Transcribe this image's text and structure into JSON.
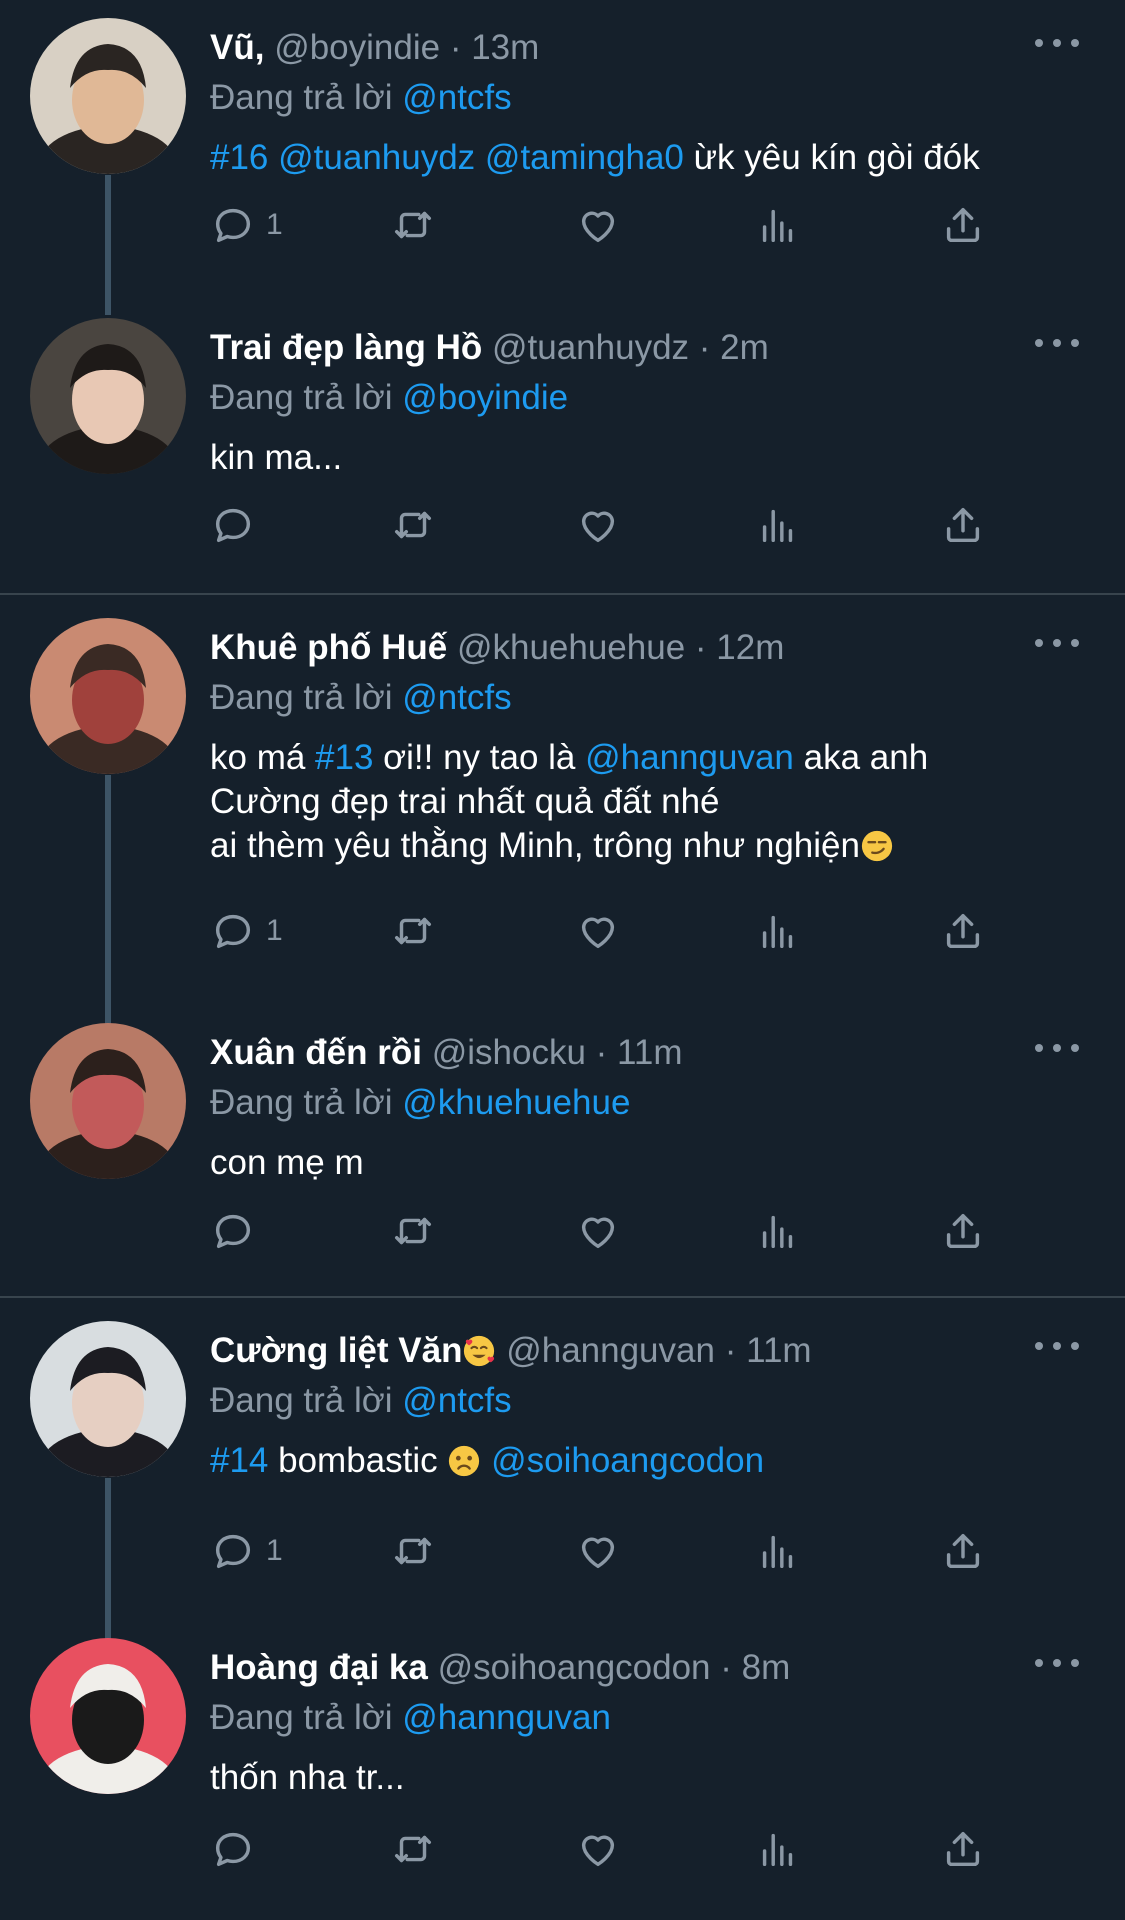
{
  "reply_prefix": "Đang trả lời",
  "tweets": [
    {
      "name": "Vũ,",
      "handle": "@boyindie",
      "time": "13m",
      "reply_to": "@ntcfs",
      "body": [
        [
          {
            "t": "#16",
            "k": "hashtag"
          },
          {
            "t": " ",
            "k": "text"
          },
          {
            "t": "@tuanhuydz",
            "k": "mention"
          },
          {
            "t": " ",
            "k": "text"
          },
          {
            "t": "@tamingha0",
            "k": "mention"
          },
          {
            "t": " ừk yêu kín gòi đók",
            "k": "text"
          }
        ]
      ],
      "reply_count": "1",
      "avatar_colors": [
        "#d8d0c4",
        "#2a2522",
        "#e0b896"
      ]
    },
    {
      "name": "Trai đẹp làng Hồ",
      "handle": "@tuanhuydz",
      "time": "2m",
      "reply_to": "@boyindie",
      "body": [
        [
          {
            "t": "kin ma...",
            "k": "text"
          }
        ]
      ],
      "reply_count": "",
      "avatar_colors": [
        "#4a4540",
        "#1e1a18",
        "#e8c8b4"
      ]
    },
    {
      "name": "Khuê phố Huế",
      "handle": "@khuehuehue",
      "time": "12m",
      "reply_to": "@ntcfs",
      "body": [
        [
          {
            "t": "ko má ",
            "k": "text"
          },
          {
            "t": "#13",
            "k": "hashtag"
          },
          {
            "t": " ơi!! ny tao là ",
            "k": "text"
          },
          {
            "t": "@hannguvan",
            "k": "mention"
          },
          {
            "t": " aka anh",
            "k": "text"
          }
        ],
        [
          {
            "t": "Cường đẹp trai nhất quả đất nhé",
            "k": "text"
          }
        ],
        [
          {
            "t": "ai thèm yêu thằng Minh, trông như nghiện",
            "k": "text"
          },
          {
            "t": "smirk",
            "k": "emoji"
          }
        ]
      ],
      "reply_count": "1",
      "avatar_colors": [
        "#c98a72",
        "#3a2a24",
        "#a0413c"
      ]
    },
    {
      "name": "Xuân đến rồi",
      "handle": "@ishocku",
      "time": "11m",
      "reply_to": "@khuehuehue",
      "body": [
        [
          {
            "t": "con mẹ m",
            "k": "text"
          }
        ]
      ],
      "reply_count": "",
      "avatar_colors": [
        "#b87a66",
        "#2c201c",
        "#c25a5a"
      ]
    },
    {
      "name": "Cường liệt Văn",
      "name_emoji": "smiling-hearts",
      "handle": "@hannguvan",
      "time": "11m",
      "reply_to": "@ntcfs",
      "body": [
        [
          {
            "t": "#14",
            "k": "hashtag"
          },
          {
            "t": " bombastic ",
            "k": "text"
          },
          {
            "t": "worried",
            "k": "emoji"
          },
          {
            "t": "  ",
            "k": "text"
          },
          {
            "t": "@soihoangcodon",
            "k": "mention"
          }
        ]
      ],
      "reply_count": "1",
      "avatar_colors": [
        "#d8dde0",
        "#1c1c22",
        "#e6cfc2"
      ]
    },
    {
      "name": "Hoàng đại ka",
      "handle": "@soihoangcodon",
      "time": "8m",
      "reply_to": "@hannguvan",
      "body": [
        [
          {
            "t": "thốn nha tr...",
            "k": "text"
          }
        ]
      ],
      "reply_count": "",
      "avatar_colors": [
        "#e85060",
        "#f0eeea",
        "#1a1a1a"
      ]
    }
  ],
  "icons": {
    "reply": "reply-icon",
    "retweet": "retweet-icon",
    "like": "heart-icon",
    "views": "views-icon",
    "share": "share-icon",
    "more": "more-icon"
  },
  "colors": {
    "background": "#15202b",
    "accent": "#1d9bf0",
    "secondary_text": "#8b98a5",
    "separator": "#38444d",
    "thread_line": "#3d5466"
  }
}
